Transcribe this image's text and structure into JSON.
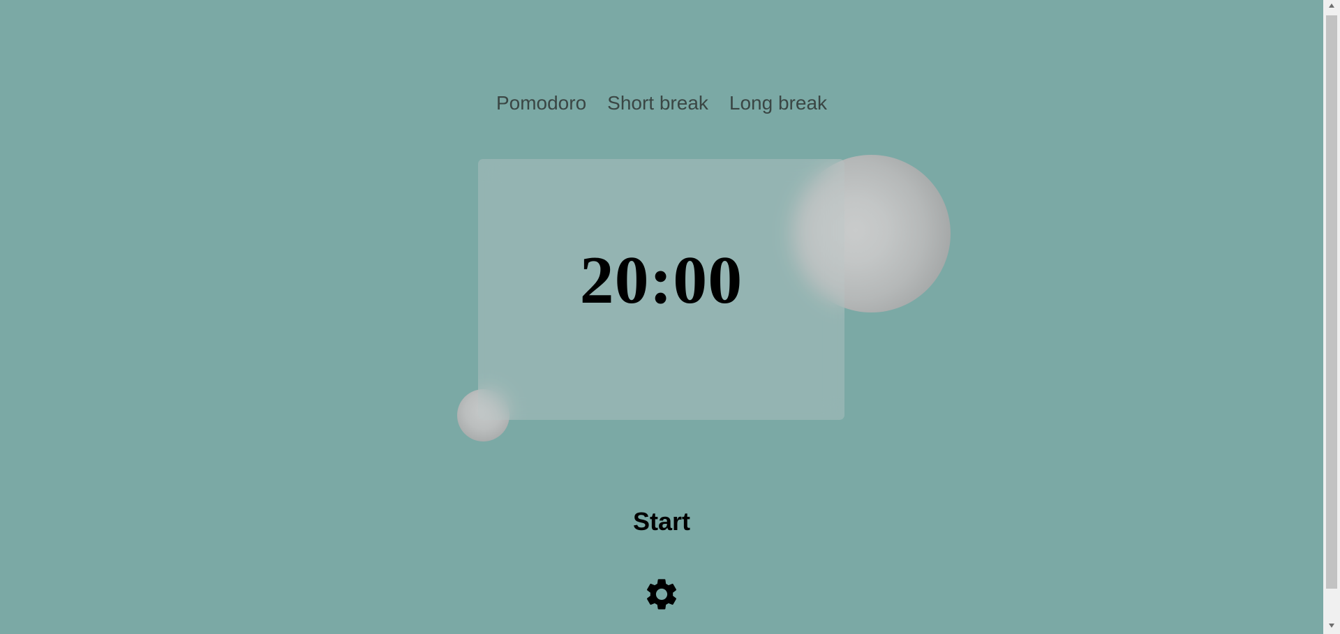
{
  "tabs": [
    "Pomodoro",
    "Short break",
    "Long break"
  ],
  "timer": {
    "display": "20:00"
  },
  "controls": {
    "start_label": "Start"
  },
  "icons": {
    "settings": "gear-icon"
  },
  "colors": {
    "background": "#7ba9a5",
    "text": "#000000",
    "tab_text": "#3a4644"
  }
}
